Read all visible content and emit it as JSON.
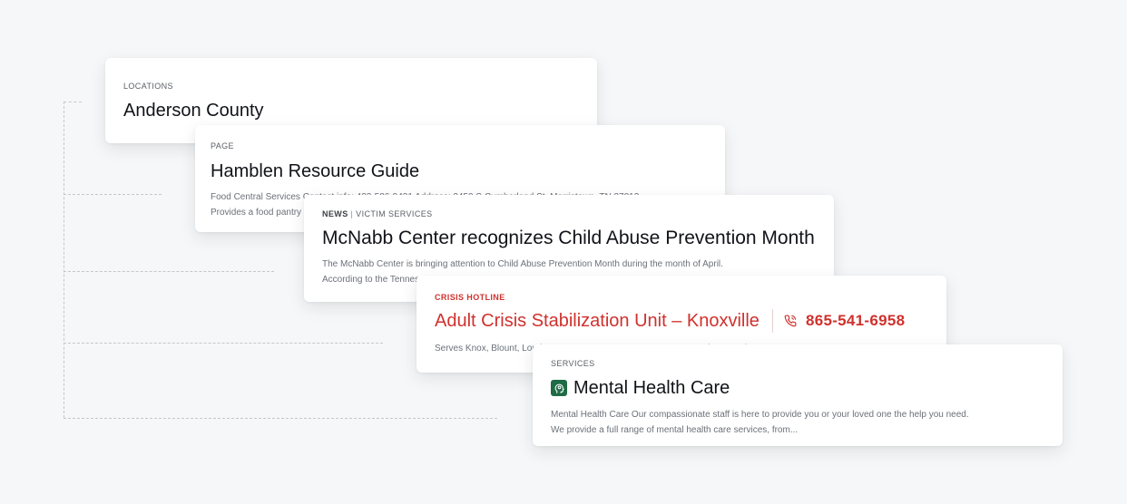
{
  "colors": {
    "background": "#f6f7f9",
    "crisis_red": "#d0312d",
    "service_green": "#1e6b46"
  },
  "results": {
    "locations": {
      "eyebrow": "LOCATIONS",
      "title": "Anderson County"
    },
    "page": {
      "eyebrow": "PAGE",
      "title": "Hamblen Resource Guide",
      "desc_line1": "Food Central Services Contact info: 423-586-9431 Address: 2450 S Cumberland St, Morristown, TN 37813",
      "desc_line2": "Provides a food pantry"
    },
    "news": {
      "eyebrow_type": "NEWS",
      "eyebrow_separator": "|",
      "eyebrow_category": "VICTIM SERVICES",
      "title": "McNabb Center recognizes Child Abuse Prevention Month",
      "desc_line1": "The McNabb Center is bringing attention to Child Abuse Prevention Month during the month of April.",
      "desc_line2": "According to the Tennessee"
    },
    "crisis": {
      "eyebrow": "CRISIS HOTLINE",
      "title": "Adult Crisis Stabilization Unit – Knoxville",
      "phone_icon": "phone-icon",
      "phone": "865-541-6958",
      "desc_line1": "Serves Knox, Blount, Loudon, Monroe, Morgan, Roane, Scott & Sevier Counties"
    },
    "services": {
      "eyebrow": "SERVICES",
      "icon": "head-brain-icon",
      "title": "Mental Health Care",
      "desc_line1": "Mental Health Care Our compassionate staff is here to provide you or your loved one the help you need.",
      "desc_line2": "We provide a full range of mental health care services, from..."
    }
  }
}
